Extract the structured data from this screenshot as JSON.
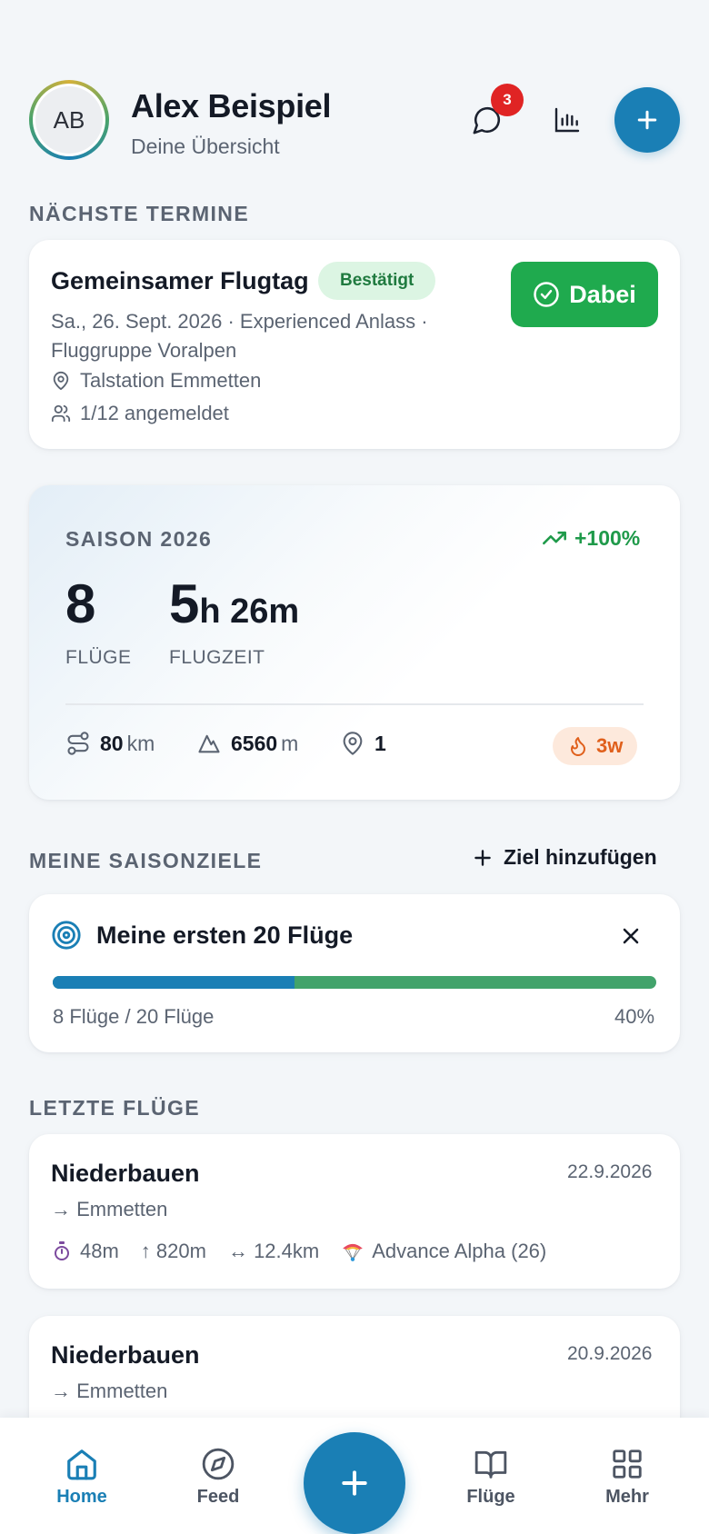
{
  "header": {
    "avatar_initials": "AB",
    "user_name": "Alex Beispiel",
    "subtitle": "Deine Übersicht",
    "notification_count": "3",
    "icons": [
      "chat-icon",
      "bar-chart-icon",
      "plus-icon"
    ]
  },
  "upcoming": {
    "section_title": "NÄCHSTE TERMINE",
    "event": {
      "title": "Gemeinsamer Flugtag",
      "status": "Bestätigt",
      "meta": "Sa., 26. Sept. 2026 · Experienced Anlass · Fluggruppe Voralpen",
      "location": "Talstation Emmetten",
      "registered": "1/12 angemeldet",
      "join_label": "Dabei"
    }
  },
  "season": {
    "label": "SAISON 2026",
    "trend": "+100%",
    "flights_value": "8",
    "flights_label": "FLÜGE",
    "time_hours": "5",
    "time_rest": "h 26m",
    "time_label": "FLUGZEIT",
    "distance_value": "80",
    "distance_unit": "km",
    "elevation_value": "6560",
    "elevation_unit": "m",
    "sites_value": "1",
    "streak": "3w"
  },
  "goals": {
    "section_title": "MEINE SAISONZIELE",
    "add_label": "Ziel hinzufügen",
    "items": [
      {
        "title": "Meine ersten 20 Flüge",
        "progress_text": "8 Flüge / 20 Flüge",
        "percent_text": "40%",
        "progress": 0.4
      }
    ]
  },
  "recent": {
    "section_title": "LETZTE FLÜGE",
    "flights": [
      {
        "name": "Niederbauen",
        "date": "22.9.2026",
        "route": "→ Emmetten",
        "duration": "48m",
        "climb": "↑ 820m",
        "distance": "↔ 12.4km",
        "glider": "Advance Alpha (26)"
      },
      {
        "name": "Niederbauen",
        "date": "20.9.2026",
        "route": "→ Emmetten"
      }
    ]
  },
  "nav": {
    "home": "Home",
    "feed": "Feed",
    "flights": "Flüge",
    "more": "Mehr"
  },
  "colors": {
    "accent": "#1a7fb5",
    "success": "#1faa4e",
    "goal_remaining": "#42a36b",
    "badge": "#e02424",
    "streak": "#e0601c"
  }
}
